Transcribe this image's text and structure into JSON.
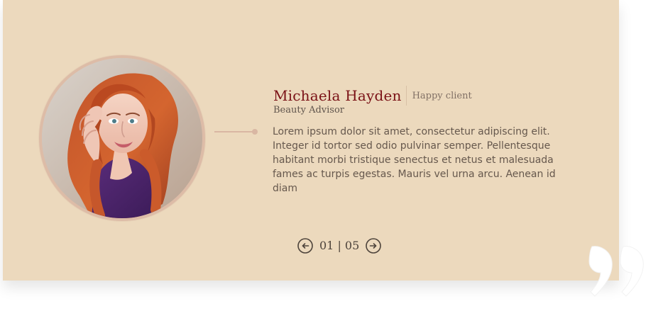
{
  "testimonial": {
    "name": "Michaela Hayden",
    "tag": "Happy client",
    "role": "Beauty Advisor",
    "text": "Lorem ipsum dolor sit amet, consectetur adipiscing elit. Integer id tortor sed odio pulvinar semper. Pellentesque habitant morbi tristique senectus et netus et malesuada fames ac turpis egestas. Mauris vel urna arcu. Aenean id diam"
  },
  "pagination": {
    "counter": "01 | 05"
  },
  "icons": {
    "previous": "arrow-left-circle-icon",
    "next": "arrow-right-circle-icon",
    "quote": "closing-quote-icon"
  },
  "colors": {
    "background": "#ecd9bd",
    "accent": "#7a1116",
    "text": "#66584d",
    "connector": "#d9b7a3"
  }
}
